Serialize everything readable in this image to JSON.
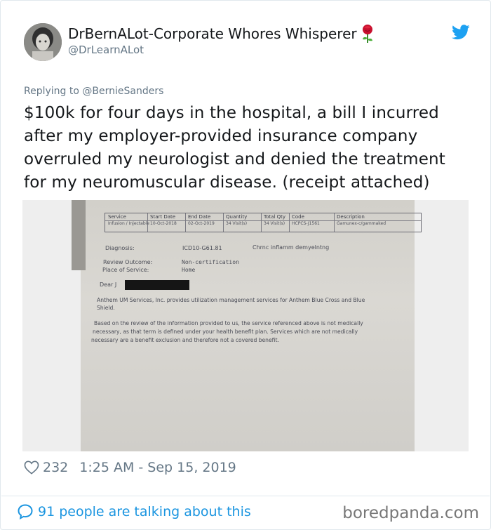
{
  "tweet": {
    "author": {
      "display_name": "DrBernALot-Corporate Whores Whisperer",
      "display_name_emoji": "rose-emoji",
      "handle": "@DrLearnALot",
      "avatar": "avatar-photo"
    },
    "platform_icon": "twitter-bird-icon",
    "replying_to_prefix": "Replying to ",
    "replying_to_user": "@BernieSanders",
    "text": "$100k for four days in the hospital, a bill I incurred after my employer-provided insurance company overruled my neurologist and denied the treatment for my neuromuscular disease. (receipt attached)",
    "attachment": {
      "table_headers": [
        "Service",
        "Start Date",
        "End Date",
        "Quantity",
        "Total Qty",
        "Code",
        "Description"
      ],
      "table_row": [
        "Infusion / Injectable",
        "10-Oct-2018",
        "02-Oct-2019",
        "34 Visit(s)",
        "34 Visit(s)",
        "HCPCS-J1561",
        "Gamunex-c/gammaked"
      ],
      "diagnosis_label": "Diagnosis:",
      "diagnosis_code": "ICD10-G61.81",
      "diagnosis_desc": "Chrnc inflamm demyelntng",
      "review_label": "Review Outcome:",
      "review_value": "Non-certification",
      "place_label": "Place of Service:",
      "place_value": "Home",
      "dear": "Dear J",
      "para1_line1": "Anthem UM Services, Inc. provides utilization management services for Anthem Blue Cross and Blue",
      "para1_line2": "Shield.",
      "para2_line1": "Based on the review of the information provided to us, the service referenced above is not medically",
      "para2_line2": "necessary, as that term is defined under your health benefit plan.  Services which are not medically",
      "para2_line3": "necessary are a benefit exclusion and therefore not a covered benefit."
    },
    "likes": "232",
    "timestamp": "1:25 AM - Sep 15, 2019",
    "conversation": "91 people are talking about this"
  },
  "watermark": "boredpanda.com",
  "colors": {
    "twitter_blue": "#1da1f2",
    "link_blue": "#1b95e0",
    "secondary_text": "#657786",
    "primary_text": "#14171a",
    "watermark": "#777777"
  }
}
